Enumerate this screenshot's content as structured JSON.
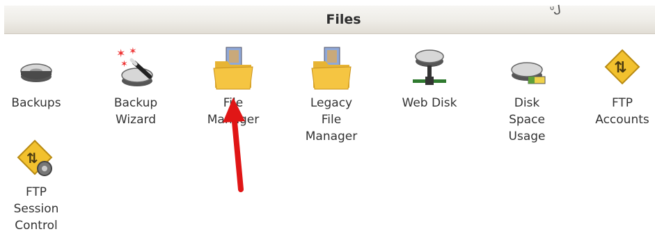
{
  "header": {
    "title": "Files",
    "scribble": "ᐡᒍ"
  },
  "items": [
    {
      "label": "Backups",
      "icon": "hard-drive-icon"
    },
    {
      "label": "Backup\nWizard",
      "icon": "backup-wizard-icon"
    },
    {
      "label": "File\nManager",
      "icon": "folder-icon"
    },
    {
      "label": "Legacy\nFile\nManager",
      "icon": "folder-icon"
    },
    {
      "label": "Web Disk",
      "icon": "network-drive-icon"
    },
    {
      "label": "Disk\nSpace\nUsage",
      "icon": "disk-usage-icon"
    },
    {
      "label": "FTP\nAccounts",
      "icon": "ftp-icon"
    },
    {
      "label": "FTP\nSession\nControl",
      "icon": "ftp-session-icon"
    }
  ],
  "colors": {
    "arrow": "#e01616",
    "folder": "#f5c542",
    "ftp": "#f2c12e"
  }
}
